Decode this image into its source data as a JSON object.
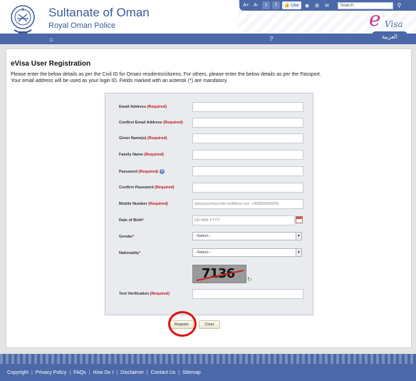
{
  "header": {
    "title": "Sultanate of Oman",
    "subtitle": "Royal Oman Police",
    "evisa_logo": {
      "e": "e",
      "text": "Visa"
    },
    "language_tab": "العربية"
  },
  "topbar": {
    "font_increase": "A+",
    "font_decrease": "A-",
    "like_label": "Like",
    "search_placeholder": "Search"
  },
  "nav": {
    "help": "?"
  },
  "page": {
    "title": "eVisa User Registration",
    "instruction_1": "Please enter the below details as per the Civil ID for Omani residents/citizens. For others, please enter the below details as per the Passport.",
    "instruction_2": "Your email address will be used as your login ID. Fields marked with an asterisk (*) are mandatory."
  },
  "form": {
    "required_tag": "(Required)",
    "email": {
      "label": "Email Address",
      "value": ""
    },
    "confirm_email": {
      "label": "Confirm Email Address",
      "value": ""
    },
    "given_names": {
      "label": "Given Name(s)",
      "value": ""
    },
    "family_name": {
      "label": "Family Name",
      "value": ""
    },
    "password": {
      "label": "Password",
      "value": ""
    },
    "confirm_password": {
      "label": "Confirm Password",
      "value": ""
    },
    "mobile": {
      "label": "Mobile Number",
      "placeholder": "(plus)countrycode mobileno (ex: +96800000000)"
    },
    "dob": {
      "label": "Date of Birth",
      "placeholder": "DD-MM-YYYY"
    },
    "gender": {
      "label": "Gender",
      "selected": "--Select--"
    },
    "nationality": {
      "label": "Nationality",
      "selected": "--Select--"
    },
    "captcha_text": "7136",
    "text_verification": {
      "label": "Text Verification",
      "value": ""
    }
  },
  "buttons": {
    "register": "Register",
    "clear": "Clear"
  },
  "footer": {
    "links": [
      "Copyright",
      "Privacy Policy",
      "FAQs",
      "How Do I",
      "Disclaimer",
      "Contact Us",
      "Sitemap"
    ]
  },
  "colors": {
    "brand_blue": "#4b68a8",
    "required_red": "#c0151d",
    "evisa_magenta": "#c0398a",
    "highlight_red": "#e01010"
  },
  "icons": [
    "emblem-logo",
    "home-icon",
    "help-icon",
    "calendar-icon",
    "refresh-icon",
    "twitter-icon",
    "facebook-icon",
    "rss-icon",
    "sitemap-icon",
    "mail-icon",
    "search-icon"
  ]
}
